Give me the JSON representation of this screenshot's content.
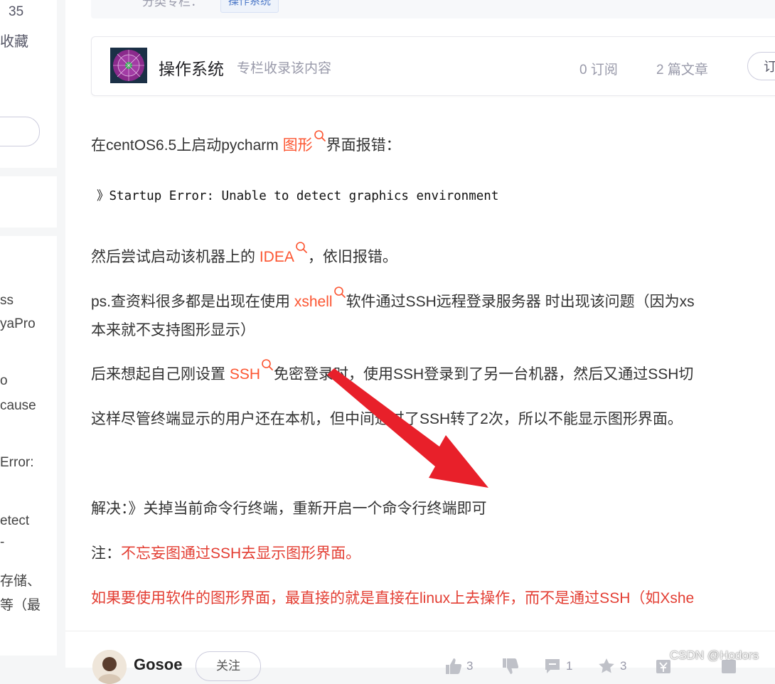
{
  "left": {
    "stat_number": "35",
    "stat_label": "收藏",
    "snippets": [
      "ss",
      "yaPro",
      "o",
      "cause",
      "Error:",
      "etect",
      "-",
      "存储、",
      "等（最"
    ]
  },
  "category": {
    "label": "分类专栏：",
    "tag": "操作系统"
  },
  "column": {
    "title": "操作系统",
    "description": "专栏收录该内容",
    "subscriptions": "0 订阅",
    "articles": "2 篇文章",
    "subscribe_button": "订阅专栏"
  },
  "article": {
    "p1_before": "在centOS6.5上启动pycharm ",
    "p1_keyword": "图形",
    "p1_after": "界面报错：",
    "code_line": "》Startup Error: Unable to detect graphics environment",
    "p2_before": "然后尝试启动该机器上的 ",
    "p2_keyword": "IDEA",
    "p2_after": "，依旧报错。",
    "p3_before": "ps.查资料很多都是出现在使用 ",
    "p3_keyword": "xshell",
    "p3_after": "软件通过SSH远程登录服务器 时出现该问题（因为xs",
    "p3_line2": "本来就不支持图形显示）",
    "p4_before": "后来想起自己刚设置 ",
    "p4_keyword": "SSH",
    "p4_after": "免密登录时，使用SSH登录到了另一台机器，然后又通过SSH切",
    "p5": "这样尽管终端显示的用户还在本机，但中间通过了SSH转了2次，所以不能显示图形界面。",
    "solution": "解决：》关掉当前命令行终端，重新开启一个命令行终端即可",
    "note_label": "注：",
    "note_red": "不忘妄图通过SSH去显示图形界面。",
    "last_red": "如果要使用软件的图形界面，最直接的就是直接在linux上去操作，而不是通过SSH（如Xshe"
  },
  "author": {
    "name": "Gosoe",
    "follow": "关注",
    "likes": "3",
    "comments": "1",
    "favorites": "3"
  },
  "watermark": "CSDN @Hodors",
  "colors": {
    "keyword": "#fc5531",
    "red_text": "#e33e33",
    "arrow": "#e8202a"
  }
}
